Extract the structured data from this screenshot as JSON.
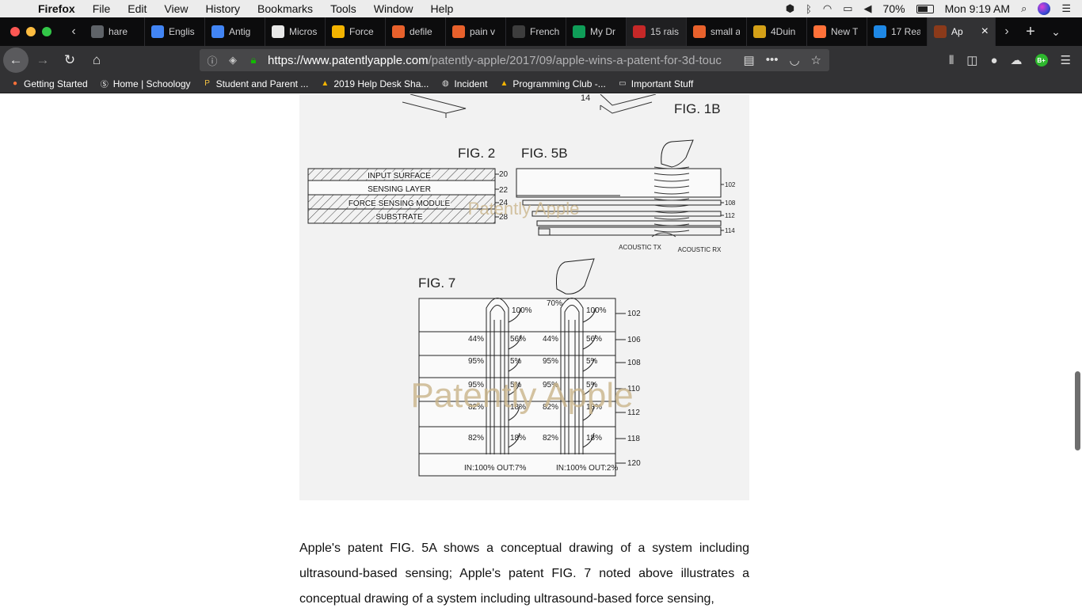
{
  "menubar": {
    "apple_icon": "apple-logo",
    "app": "Firefox",
    "items": [
      "File",
      "Edit",
      "View",
      "History",
      "Bookmarks",
      "Tools",
      "Window",
      "Help"
    ],
    "battery": "70%",
    "battery_level": 0.7,
    "clock": "Mon 9:19 AM"
  },
  "tabs": [
    {
      "title": "hare",
      "icon": "gdrive-file",
      "color": "#5f6368"
    },
    {
      "title": "Englis",
      "icon": "google-docs",
      "color": "#4285f4"
    },
    {
      "title": "Antig",
      "icon": "google-docs",
      "color": "#4285f4"
    },
    {
      "title": "Micros",
      "icon": "blank-page",
      "color": "#e8e8e8"
    },
    {
      "title": "Force",
      "icon": "google-slides",
      "color": "#f4b400"
    },
    {
      "title": "defile",
      "icon": "firefox-orange",
      "color": "#e8612c"
    },
    {
      "title": "pain v",
      "icon": "firefox-orange",
      "color": "#e8612c"
    },
    {
      "title": "French",
      "icon": "schoology",
      "color": "#3d3d3d"
    },
    {
      "title": "My Dr",
      "icon": "google-drive",
      "color": "#0f9d58"
    },
    {
      "title": "15 rais",
      "icon": "red-bookmark",
      "color": "#c62828"
    },
    {
      "title": "small a",
      "icon": "firefox-orange",
      "color": "#e8612c"
    },
    {
      "title": "4Duin",
      "icon": "character-face",
      "color": "#d4a017"
    },
    {
      "title": "New T",
      "icon": "firefox",
      "color": "#ff7139"
    },
    {
      "title": "17 Rea",
      "icon": "wordpress-blue",
      "color": "#1e88e5"
    },
    {
      "title": "Ap",
      "icon": "patently-apple",
      "color": "#8b3a1a"
    }
  ],
  "nav": {
    "url_host": "https://www.patentlyapple.com",
    "url_path": "/patently-apple/2017/09/apple-wins-a-patent-for-3d-touc"
  },
  "bookmarks": [
    {
      "label": "Getting Started",
      "icon": "firefox-icon"
    },
    {
      "label": "Home | Schoology",
      "icon": "schoology-icon"
    },
    {
      "label": "Student and Parent ...",
      "icon": "p-icon"
    },
    {
      "label": "2019 Help Desk Sha...",
      "icon": "google-drive-icon"
    },
    {
      "label": "Incident",
      "icon": "globe-icon"
    },
    {
      "label": "Programming Club -...",
      "icon": "google-drive-icon"
    },
    {
      "label": "Important Stuff",
      "icon": "folder-icon"
    }
  ],
  "figure": {
    "fig1b": "FIG. 1B",
    "fig1b_ref": "14",
    "fig2": "FIG. 2",
    "fig2_layers": [
      "INPUT SURFACE",
      "SENSING LAYER",
      "FORCE SENSING MODULE",
      "SUBSTRATE"
    ],
    "fig2_refs": [
      "20",
      "22",
      "24",
      "28"
    ],
    "fig5b": "FIG. 5B",
    "fig5b_refs": [
      "102",
      "108",
      "112",
      "114"
    ],
    "acoustic_tx": "ACOUSTIC TX",
    "acoustic_rx": "ACOUSTIC RX",
    "fig7": "FIG. 7",
    "fig7_refs": [
      "102",
      "106",
      "108",
      "110",
      "112",
      "118",
      "120"
    ],
    "fig7_top": [
      "100%",
      "70%",
      "100%"
    ],
    "fig7_rows": [
      {
        "left": "44%",
        "right": "56%"
      },
      {
        "left": "95%",
        "right": "5%"
      },
      {
        "left": "95%",
        "right": "5%"
      },
      {
        "left": "82%",
        "right": "18%"
      },
      {
        "left": "82%",
        "right": "18%"
      }
    ],
    "fig7_bottom_left": "IN:100% OUT:7%",
    "fig7_bottom_right": "IN:100% OUT:2%",
    "watermark": "Patently Apple"
  },
  "article": {
    "text": "Apple's patent FIG. 5A shows a conceptual drawing of a system including ultrasound-based sensing; Apple's patent FIG. 7 noted above illustrates a conceptual drawing of a system including ultrasound-based force sensing,"
  }
}
